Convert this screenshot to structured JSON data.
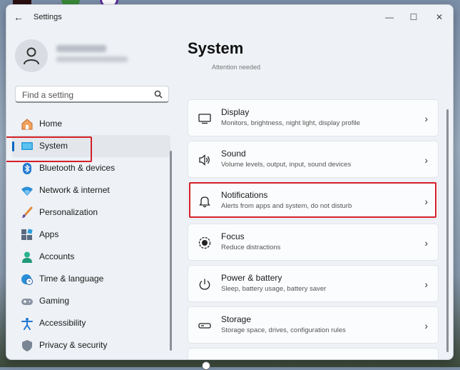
{
  "window": {
    "title": "Settings"
  },
  "controls": {
    "minimize": "—",
    "maximize": "☐",
    "close": "✕"
  },
  "search": {
    "placeholder": "Find a setting"
  },
  "sidebar": {
    "items": [
      {
        "label": "Home",
        "icon": "home-icon"
      },
      {
        "label": "System",
        "icon": "monitor-icon"
      },
      {
        "label": "Bluetooth & devices",
        "icon": "bluetooth-icon"
      },
      {
        "label": "Network & internet",
        "icon": "wifi-icon"
      },
      {
        "label": "Personalization",
        "icon": "brush-icon"
      },
      {
        "label": "Apps",
        "icon": "apps-icon"
      },
      {
        "label": "Accounts",
        "icon": "person-icon"
      },
      {
        "label": "Time & language",
        "icon": "globe-clock-icon"
      },
      {
        "label": "Gaming",
        "icon": "gamepad-icon"
      },
      {
        "label": "Accessibility",
        "icon": "accessibility-icon"
      },
      {
        "label": "Privacy & security",
        "icon": "shield-icon"
      }
    ],
    "selected": "System"
  },
  "main": {
    "title": "System",
    "attention": "Attention needed",
    "cards": [
      {
        "title": "Display",
        "subtitle": "Monitors, brightness, night light, display profile",
        "icon": "display-icon"
      },
      {
        "title": "Sound",
        "subtitle": "Volume levels, output, input, sound devices",
        "icon": "speaker-icon"
      },
      {
        "title": "Notifications",
        "subtitle": "Alerts from apps and system, do not disturb",
        "icon": "bell-icon"
      },
      {
        "title": "Focus",
        "subtitle": "Reduce distractions",
        "icon": "focus-icon"
      },
      {
        "title": "Power & battery",
        "subtitle": "Sleep, battery usage, battery saver",
        "icon": "power-icon"
      },
      {
        "title": "Storage",
        "subtitle": "Storage space, drives, configuration rules",
        "icon": "storage-icon"
      }
    ]
  },
  "colors": {
    "accent": "#0067c0",
    "highlight_box": "#d3202a"
  }
}
